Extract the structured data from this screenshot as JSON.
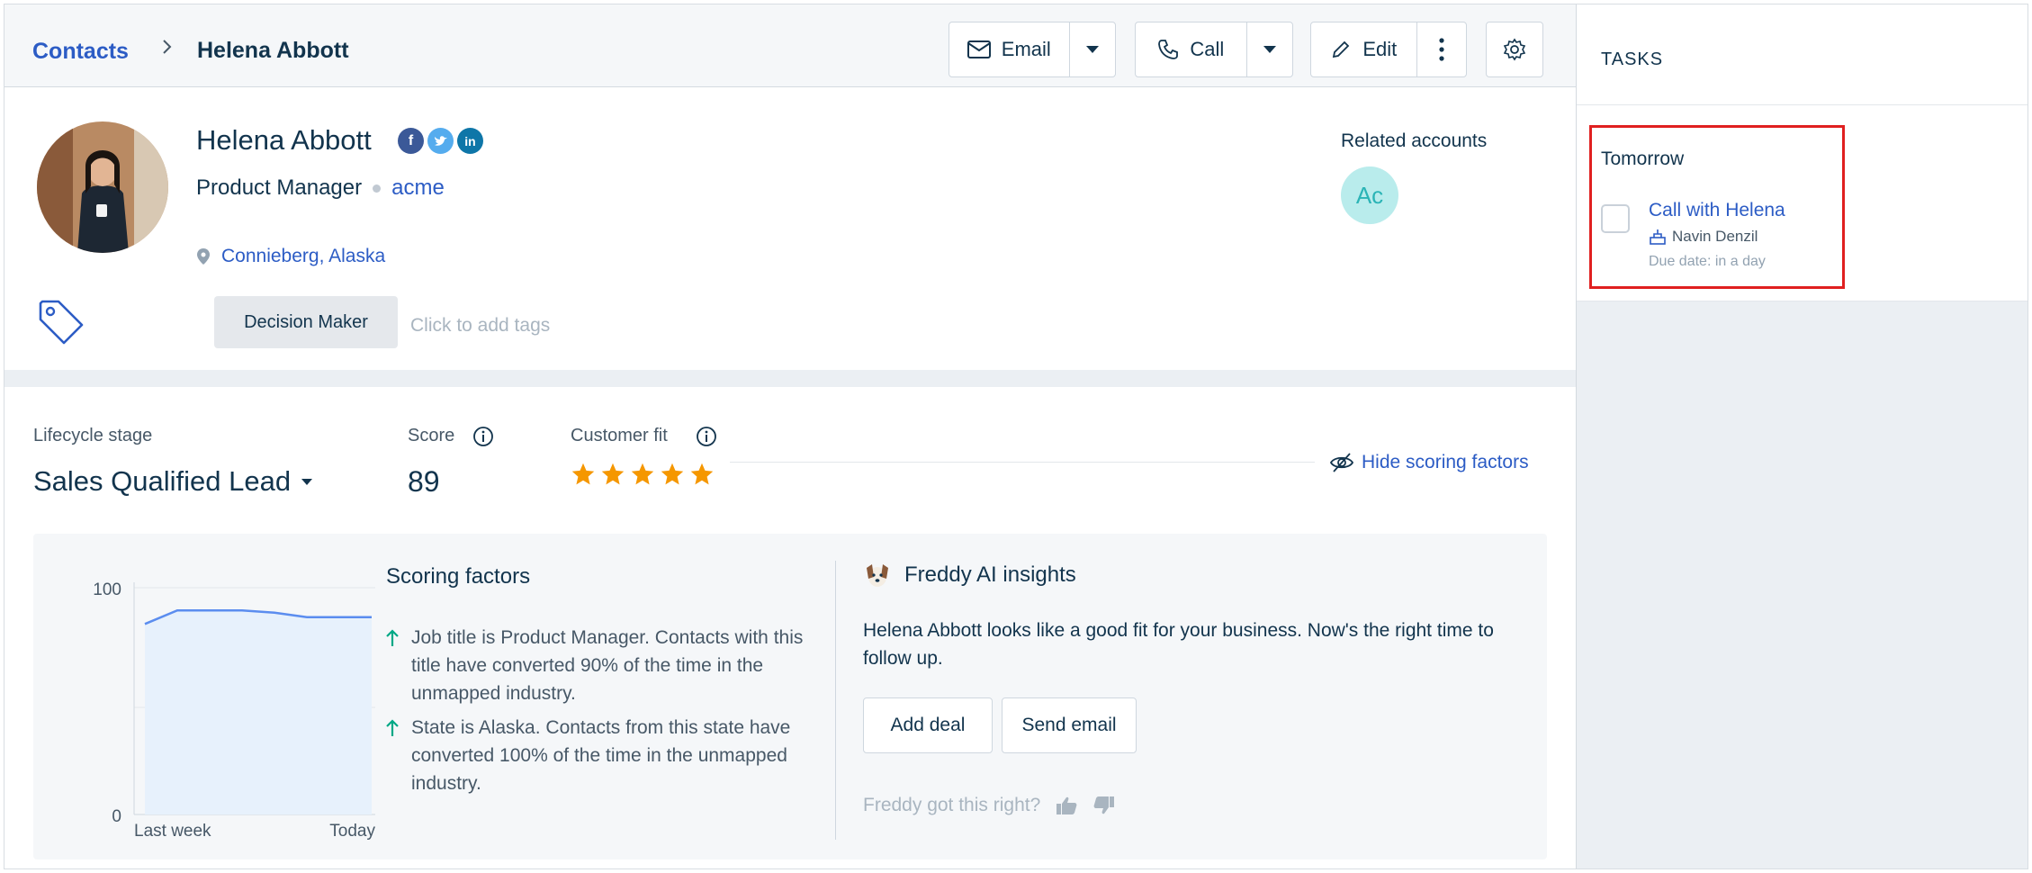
{
  "breadcrumb": {
    "root": "Contacts",
    "current": "Helena Abbott"
  },
  "toolbar": {
    "email": "Email",
    "call": "Call",
    "edit": "Edit"
  },
  "contact": {
    "name": "Helena Abbott",
    "title": "Product Manager",
    "company": "acme",
    "location": "Connieberg, Alaska",
    "tag": "Decision Maker",
    "tag_placeholder": "Click to add tags"
  },
  "related": {
    "label": "Related accounts",
    "initials": "Ac"
  },
  "lifecycle": {
    "stage_label": "Lifecycle stage",
    "stage": "Sales Qualified Lead",
    "score_label": "Score",
    "score": "89",
    "fit_label": "Customer fit",
    "fit_stars": 5,
    "hide_link": "Hide scoring factors"
  },
  "chart_data": {
    "type": "area",
    "x": [
      "Last week",
      "",
      "",
      "",
      "",
      "",
      "",
      "Today"
    ],
    "values": [
      84,
      90,
      90,
      90,
      89,
      87,
      87,
      87
    ],
    "ylim": [
      0,
      100
    ],
    "y_ticks": [
      "100",
      "0"
    ],
    "x_ticks": [
      "Last week",
      "Today"
    ],
    "colors": {
      "line": "#5b8def",
      "fill": "#e7f1fc"
    }
  },
  "scoring": {
    "title": "Scoring factors",
    "factors": [
      "Job title is Product Manager. Contacts with this title have converted 90% of the time in the unmapped industry.",
      "State is Alaska. Contacts from this state have converted 100% of the time in the unmapped industry."
    ]
  },
  "freddy": {
    "title": "Freddy AI insights",
    "text": "Helena Abbott looks like a good fit for your business. Now's the right time to follow up.",
    "add_deal": "Add deal",
    "send_email": "Send email",
    "feedback": "Freddy got this right?"
  },
  "tasks": {
    "title": "TASKS",
    "group": "Tomorrow",
    "item": {
      "name": "Call with Helena",
      "owner": "Navin Denzil",
      "due": "Due date: in a day"
    }
  },
  "colors": {
    "link": "#2c5cc5",
    "star": "#f59700",
    "highlight": "#e02020"
  }
}
